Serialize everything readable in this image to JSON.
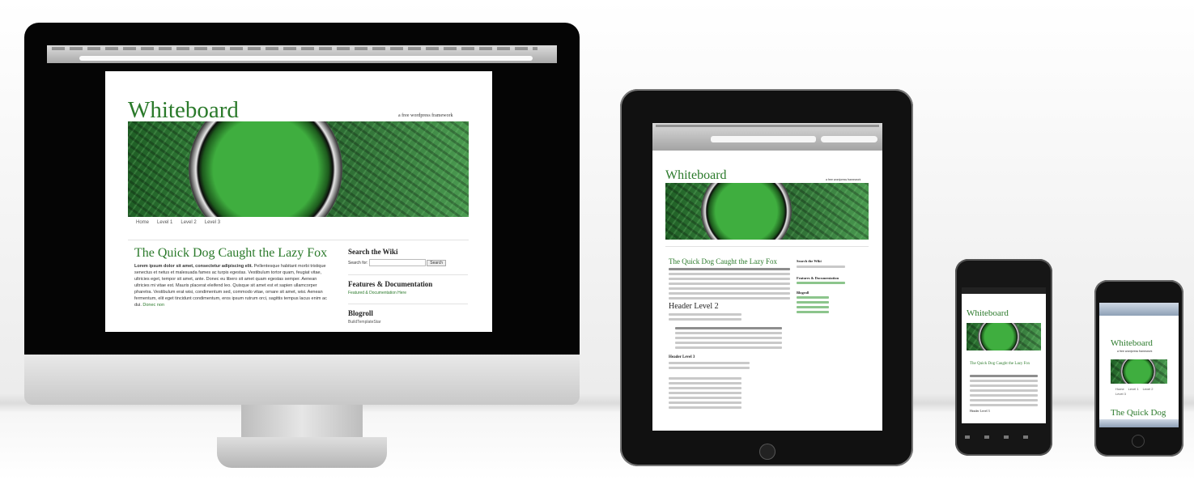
{
  "site": {
    "name": "Whiteboard",
    "tagline": "a free wordpress framework",
    "nav": [
      "Home",
      "Level 1",
      "Level 2",
      "Level 3"
    ],
    "post_title": "The Quick Dog Caught the Lazy Fox",
    "post_lead": "Lorem ipsum dolor sit amet, consectetur adipiscing elit.",
    "post_body": "Pellentesque habitant morbi tristique senectus et netus et malesuada fames ac turpis egestas. Vestibulum tortor quam, feugiat vitae, ultricies eget, tempor sit amet, ante. Donec eu libero sit amet quam egestas semper. Aenean ultricies mi vitae est. Mauris placerat eleifend leo. Quisque sit amet est et sapien ullamcorper pharetra. Vestibulum erat wisi, condimentum sed, commodo vitae, ornare sit amet, wisi. Aenean fermentum, elit eget tincidunt condimentum, eros ipsum rutrum orci, sagittis tempus lacus enim ac dui.",
    "post_link": "Donec non",
    "header2": "Header Level 2",
    "header3": "Header Level 3",
    "sidebar": {
      "search_title": "Search the Wiki",
      "search_label": "Search for:",
      "search_button": "Search",
      "features_title": "Features & Documentation",
      "features_link": "Featured & Documentation Here",
      "blogroll_title": "Blogroll",
      "blogroll_first": "BuildTemplateStar"
    }
  }
}
